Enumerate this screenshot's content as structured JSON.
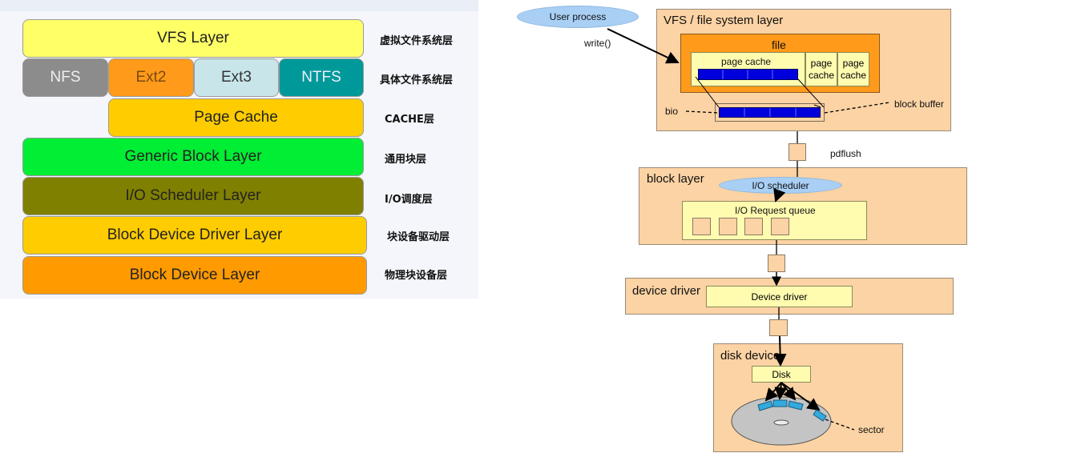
{
  "left_stack": {
    "layers": {
      "vfs": {
        "label": "VFS Layer",
        "color": "#ffff66"
      },
      "nfs": {
        "label": "NFS",
        "color": "#8c8c8c"
      },
      "ext2": {
        "label": "Ext2",
        "color": "#ff9a1a"
      },
      "ext3": {
        "label": "Ext3",
        "color": "#c8e6ea"
      },
      "ntfs": {
        "label": "NTFS",
        "color": "#009999"
      },
      "page_cache": {
        "label": "Page Cache",
        "color": "#ffcc00"
      },
      "generic_block": {
        "label": "Generic Block Layer",
        "color": "#00ee33"
      },
      "io_scheduler": {
        "label": "I/O Scheduler Layer",
        "color": "#808000"
      },
      "block_driver": {
        "label": "Block Device Driver Layer",
        "color": "#ffcc00"
      },
      "block_device": {
        "label": "Block Device Layer",
        "color": "#ff9a00"
      }
    },
    "cn_labels": {
      "vfs": "虚拟文件系统层",
      "concrete_fs": "具体文件系统层",
      "cache": "CACHE层",
      "generic_block": "通用块层",
      "io_scheduler": "I/O调度层",
      "block_driver": "块设备驱动层",
      "block_device": "物理块设备层"
    }
  },
  "right_diagram": {
    "user_process": "User process",
    "write_call": "write()",
    "vfs_layer": {
      "title": "VFS / file system layer",
      "file_label": "file",
      "page_cache": "page cache",
      "page_cache_small_1": "page\ncache",
      "page_cache_small_2": "page\ncache",
      "bio": "bio",
      "block_buffer": "block buffer"
    },
    "pdflush": "pdflush",
    "block_layer": {
      "title": "block layer",
      "io_scheduler": "I/O scheduler",
      "request_queue": "I/O Request queue"
    },
    "device_driver": {
      "title": "device driver",
      "inner": "Device driver"
    },
    "disk_device": {
      "title": "disk device",
      "disk": "Disk",
      "sector": "sector"
    },
    "colors": {
      "peach": "#fcd3a4",
      "light_yellow": "#fffcb0",
      "orange": "#ff9a1a",
      "buffer_blue": "#0000dd",
      "ellipse_blue": "#a9cff5",
      "sector_cyan": "#33aadd"
    }
  }
}
